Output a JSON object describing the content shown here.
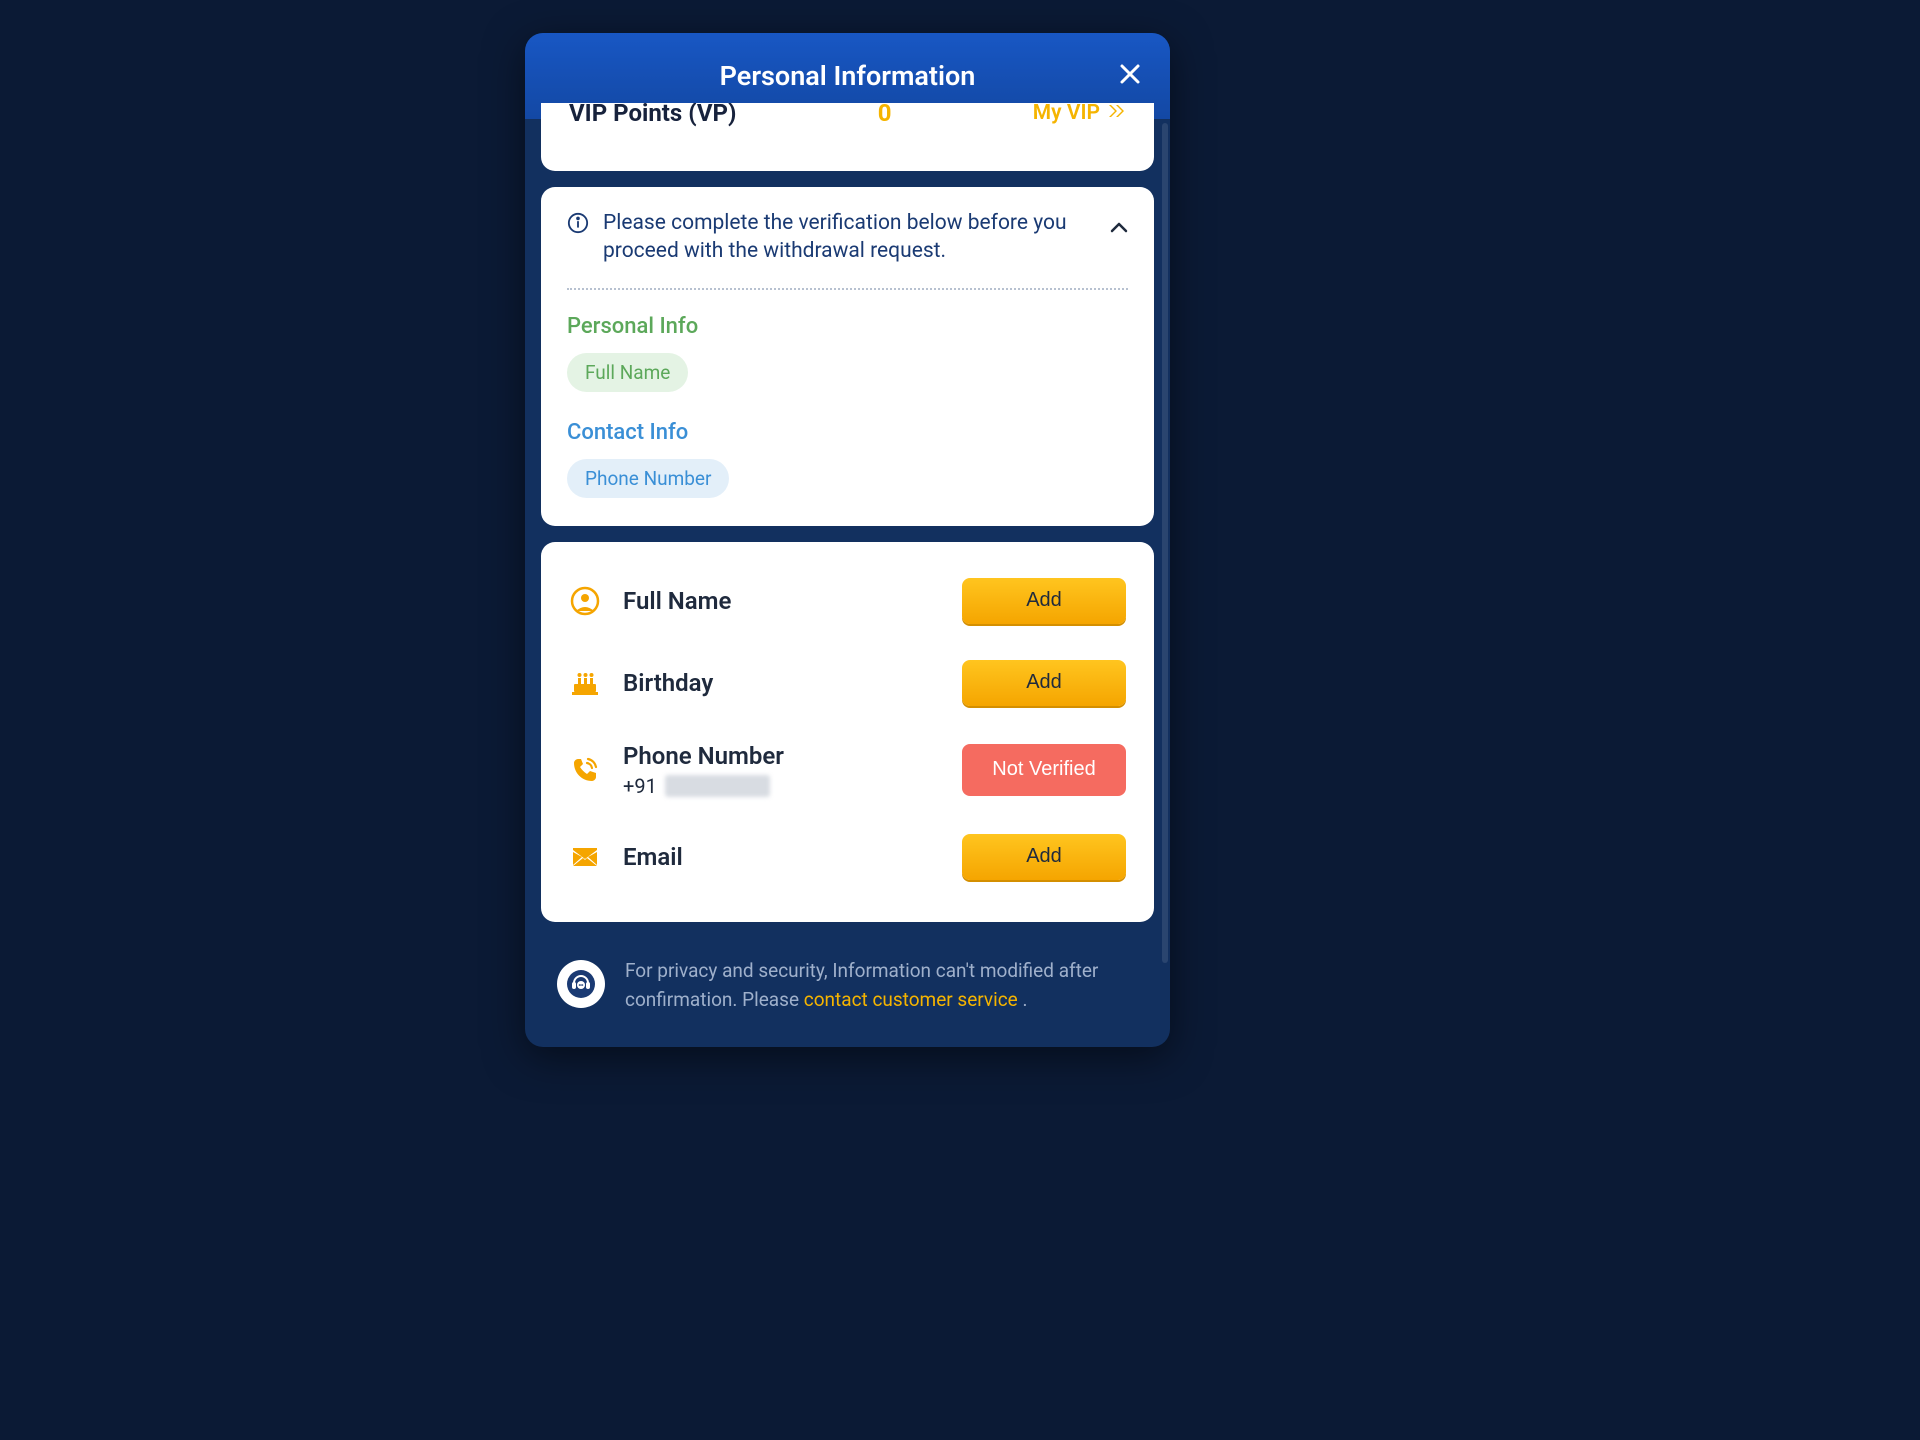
{
  "header": {
    "title": "Personal Information"
  },
  "vip": {
    "label": "VIP Points (VP)",
    "value": "0",
    "link": "My VIP"
  },
  "verification": {
    "message": "Please complete the verification below before you proceed with the withdrawal request.",
    "personal_title": "Personal Info",
    "personal_pill": "Full Name",
    "contact_title": "Contact Info",
    "contact_pill": "Phone Number"
  },
  "fields": {
    "full_name": {
      "label": "Full Name",
      "action": "Add"
    },
    "birthday": {
      "label": "Birthday",
      "action": "Add"
    },
    "phone": {
      "label": "Phone Number",
      "prefix": "+91",
      "action": "Not Verified"
    },
    "email": {
      "label": "Email",
      "action": "Add"
    }
  },
  "footer": {
    "text_a": "For privacy and security, Information can't modified after confirmation. Please ",
    "link": "contact customer service",
    "text_b": " ."
  }
}
